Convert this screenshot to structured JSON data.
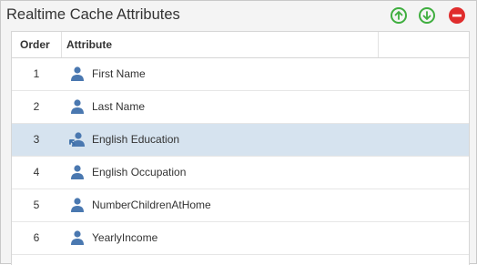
{
  "panel": {
    "title": "Realtime Cache Attributes",
    "buttons": {
      "move_up": "arrow-up-circle-icon",
      "move_down": "arrow-down-circle-icon",
      "remove": "remove-circle-icon"
    }
  },
  "colors": {
    "accent_green": "#3fae3f",
    "remove_red": "#e02d2d",
    "selected_row": "#d6e3ef",
    "user_icon": "#4a78b0"
  },
  "grid": {
    "columns": [
      "Order",
      "Attribute"
    ],
    "rows": [
      {
        "order": "1",
        "attribute": "First Name",
        "icon": "user-icon",
        "selected": false
      },
      {
        "order": "2",
        "attribute": "Last Name",
        "icon": "user-icon",
        "selected": false
      },
      {
        "order": "3",
        "attribute": "English Education",
        "icon": "user-move-icon",
        "selected": true
      },
      {
        "order": "4",
        "attribute": "English Occupation",
        "icon": "user-icon",
        "selected": false
      },
      {
        "order": "5",
        "attribute": "NumberChildrenAtHome",
        "icon": "user-icon",
        "selected": false
      },
      {
        "order": "6",
        "attribute": "YearlyIncome",
        "icon": "user-icon",
        "selected": false
      }
    ]
  }
}
